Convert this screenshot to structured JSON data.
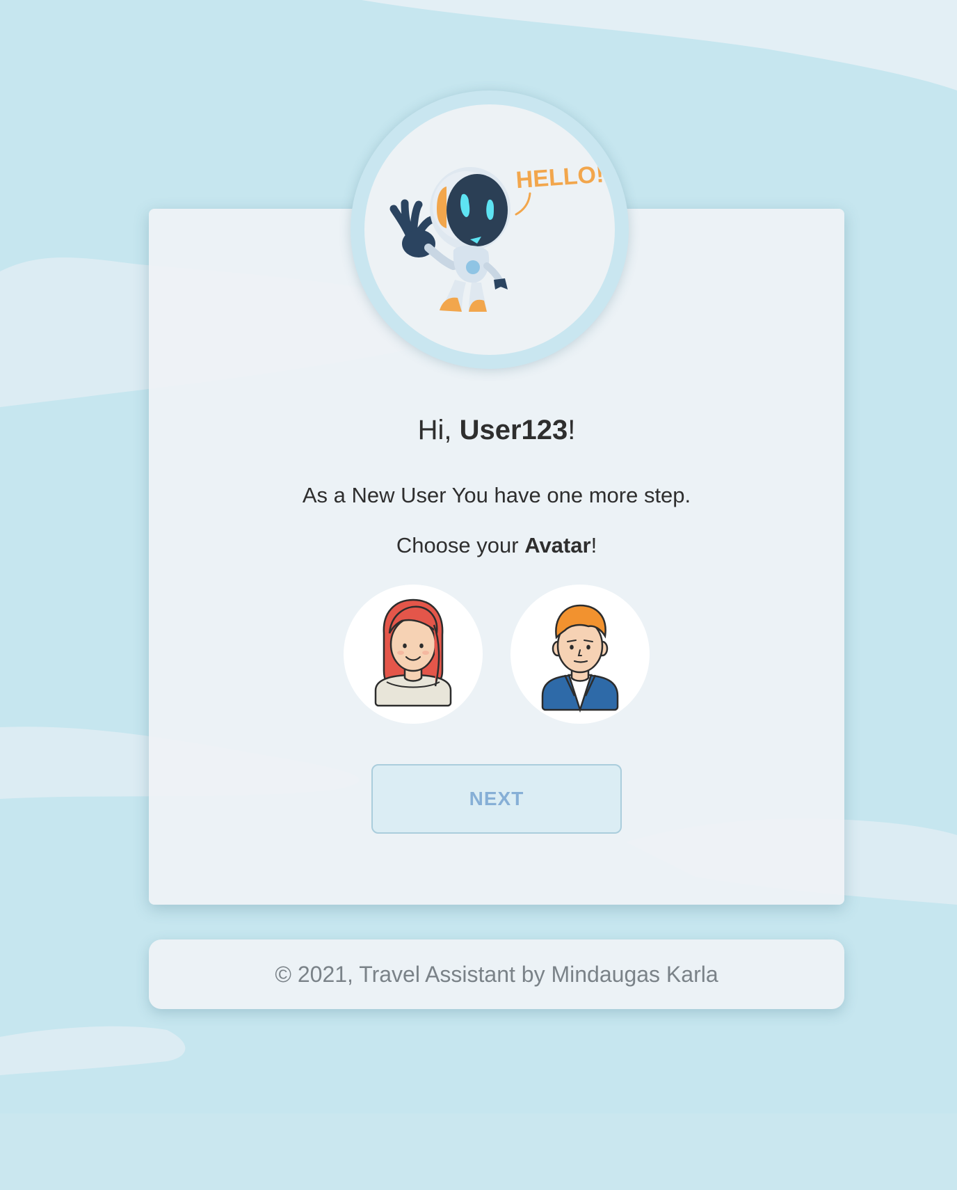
{
  "robot": {
    "speech": "HELLO!"
  },
  "greeting": {
    "prefix": "Hi, ",
    "username": "User123",
    "suffix": "!"
  },
  "message": {
    "step": "As a New User You have one more step.",
    "choose_prefix": "Choose your ",
    "choose_bold": "Avatar",
    "choose_suffix": "!"
  },
  "avatars": [
    {
      "name": "female-avatar"
    },
    {
      "name": "male-avatar"
    }
  ],
  "next_button": {
    "label": "NEXT"
  },
  "footer": {
    "text": "© 2021, Travel Assistant by Mindaugas Karla"
  },
  "colors": {
    "background": "#c6e6ef",
    "card": "#eef2f5",
    "button_text": "#86afd6",
    "robot_accent": "#f2a64c"
  }
}
